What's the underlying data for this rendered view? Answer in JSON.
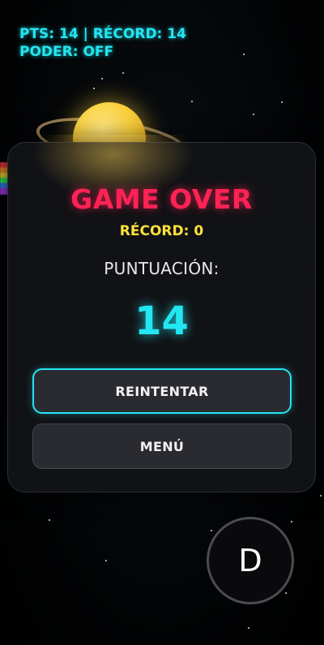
{
  "hud": {
    "score_line": "PTS: 14 | RÉCORD: 14",
    "power_line": "PODER: OFF"
  },
  "game_over": {
    "title": "GAME OVER",
    "record": "RÉCORD: 0",
    "score_label": "PUNTUACIÓN:",
    "score_value": "14",
    "retry_label": "REINTENTAR",
    "menu_label": "MENÚ"
  },
  "controls": {
    "action_button_label": "D"
  },
  "colors": {
    "accent_cyan": "#22e6f2",
    "title_red": "#ff2255",
    "record_yellow": "#ffe23a",
    "planet": "#f9cf3c"
  }
}
